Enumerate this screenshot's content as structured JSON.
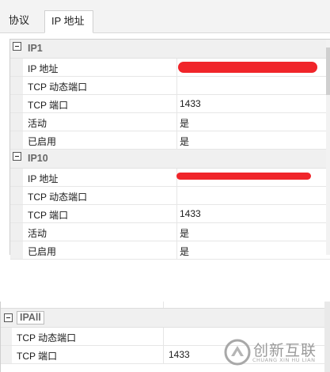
{
  "tabs": [
    {
      "label": "协议"
    },
    {
      "label": "IP 地址"
    }
  ],
  "groups": [
    {
      "label": "IP1",
      "rows": [
        {
          "property": "IP 地址",
          "value": ""
        },
        {
          "property": "TCP 动态端口",
          "value": ""
        },
        {
          "property": "TCP 端口",
          "value": "1433"
        },
        {
          "property": "活动",
          "value": "是"
        },
        {
          "property": "已启用",
          "value": "是"
        }
      ]
    },
    {
      "label": "IP10",
      "rows": [
        {
          "property": "IP 地址",
          "value": ""
        },
        {
          "property": "TCP 动态端口",
          "value": ""
        },
        {
          "property": "TCP 端口",
          "value": "1433"
        },
        {
          "property": "活动",
          "value": "是"
        },
        {
          "property": "已启用",
          "value": "是"
        }
      ]
    }
  ],
  "ipall": {
    "label": "IPAll",
    "rows": [
      {
        "property": "TCP 动态端口",
        "value": ""
      },
      {
        "property": "TCP 端口",
        "value": "1433"
      }
    ]
  },
  "watermark": {
    "text": "创新互联",
    "subtext": "CHUANG XIN HU LIAN"
  },
  "colors": {
    "redaction": "#f0252a",
    "category_bg": "#f0f0f0"
  }
}
